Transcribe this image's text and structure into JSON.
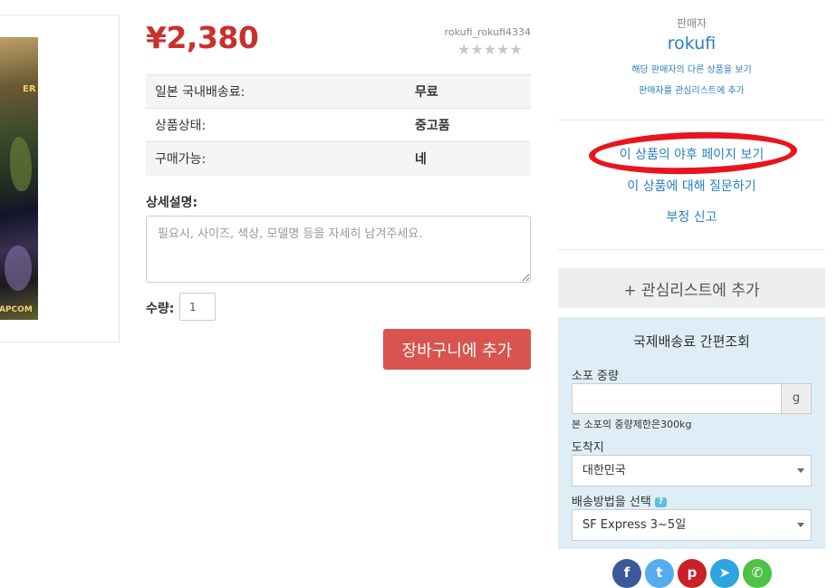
{
  "product": {
    "image_text_top": "ER",
    "image_text_bottom": "APCOM",
    "price": "¥2,380",
    "seller_id": "rokufi_rokufi4334",
    "stars": "★★★★★",
    "rating_stars": 0
  },
  "info_rows": [
    {
      "key": "일본 국내배송료:",
      "value": "무료"
    },
    {
      "key": "상품상태:",
      "value": "중고품"
    },
    {
      "key": "구매가능:",
      "value": "네"
    }
  ],
  "request": {
    "desc_label": "상세설명:",
    "desc_placeholder": "필요시, 사이즈, 색상, 모델명 등을 자세히 남겨주세요.",
    "qty_label": "수량:",
    "qty_value": "1",
    "cart_button": "장바구니에 추가"
  },
  "seller": {
    "caption": "판매자",
    "name": "rokufi",
    "link_other": "해당 판매자의 다른 상품을 보기",
    "link_watch": "판매자를 관심리스트에 추가"
  },
  "actions": {
    "view_yahoo": "이 상품의 야후 페이지 보기",
    "ask_question": "이 상품에 대해 질문하기",
    "report": "부정 신고",
    "watchlist_button": "+ 관심리스트에 추가"
  },
  "shipping": {
    "title": "국제배송료 간편조회",
    "weight_label": "소포 중량",
    "weight_value": "",
    "weight_unit": "g",
    "weight_note": "본 소포의 중량제한은300kg",
    "dest_label": "도착지",
    "dest_value": "대한민국",
    "method_label": "배송방법을 선택",
    "method_help": "?",
    "method_value": "SF Express 3~5일"
  },
  "social": [
    {
      "icon": "facebook-icon",
      "glyph": "f",
      "color": "#3b5998"
    },
    {
      "icon": "twitter-icon",
      "glyph": "t",
      "color": "#55acee"
    },
    {
      "icon": "pinterest-icon",
      "glyph": "p",
      "color": "#cb2027"
    },
    {
      "icon": "telegram-icon",
      "glyph": "➤",
      "color": "#2ca5e0"
    },
    {
      "icon": "whatsapp-icon",
      "glyph": "✆",
      "color": "#4dc247"
    }
  ],
  "colors": {
    "price_red": "#c9302c",
    "button_red": "#d9534f",
    "link_blue": "#2a7fc1",
    "shipping_bg": "#dfedf7",
    "annotation_red": "#e8141e"
  }
}
